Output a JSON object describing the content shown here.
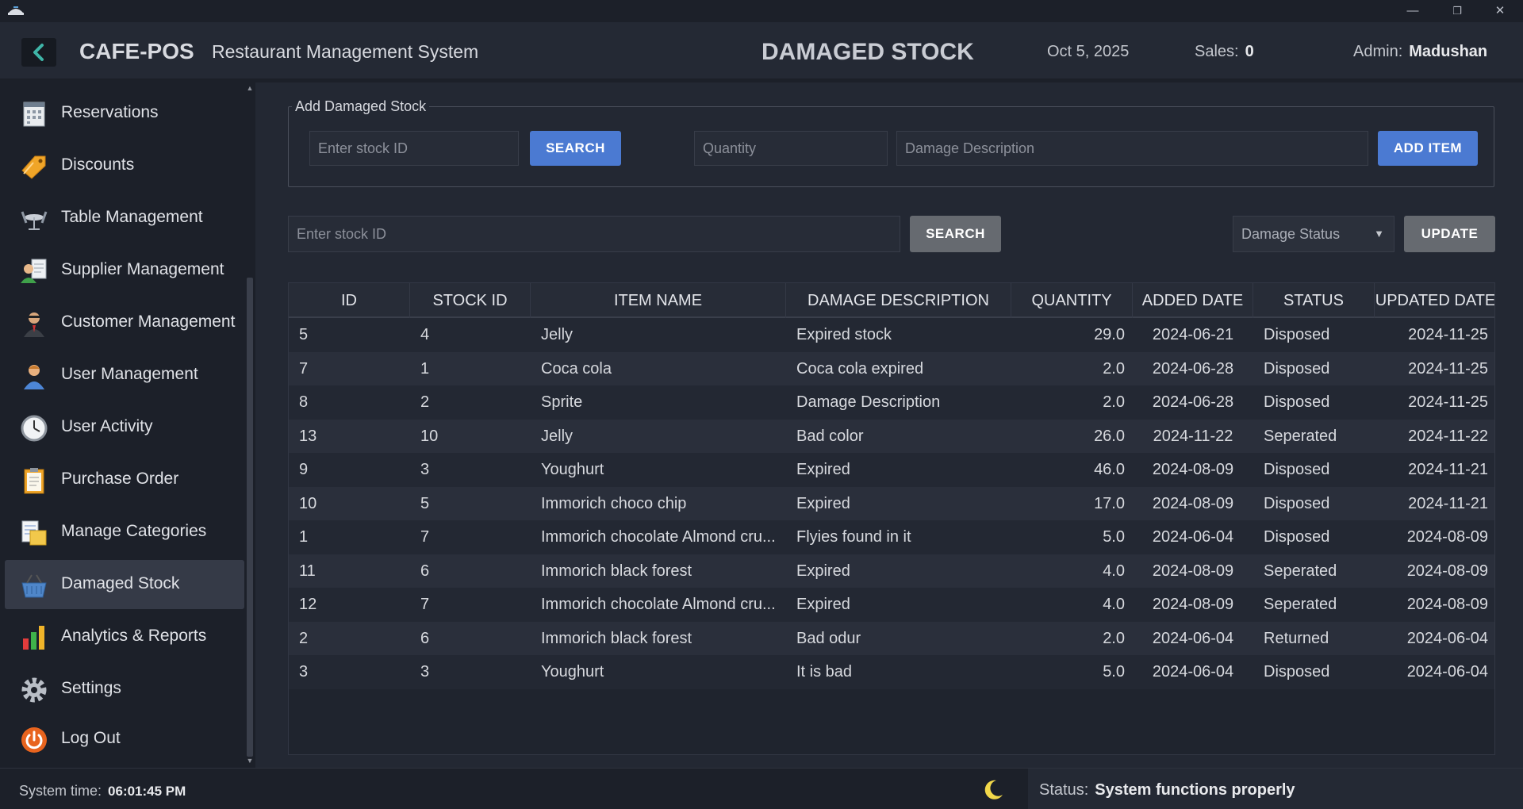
{
  "window": {
    "minimize_glyph": "—",
    "restore_glyph": "❐",
    "close_glyph": "✕"
  },
  "header": {
    "brand": "CAFE-POS",
    "subtitle": "Restaurant Management System",
    "page_title": "DAMAGED STOCK",
    "date": "Oct 5, 2025",
    "sales_label": "Sales:",
    "sales_value": "0",
    "admin_label": "Admin:",
    "admin_name": "Madushan"
  },
  "sidebar": {
    "items": [
      {
        "label": "Reservations",
        "icon": "reservations-icon",
        "active": false
      },
      {
        "label": "Discounts",
        "icon": "discount-tag-icon",
        "active": false
      },
      {
        "label": "Table Management",
        "icon": "table-icon",
        "active": false
      },
      {
        "label": "Supplier Management",
        "icon": "supplier-icon",
        "active": false
      },
      {
        "label": "Customer Management",
        "icon": "customer-icon",
        "active": false
      },
      {
        "label": "User Management",
        "icon": "user-icon",
        "active": false
      },
      {
        "label": "User Activity",
        "icon": "clock-icon",
        "active": false
      },
      {
        "label": "Purchase Order",
        "icon": "clipboard-icon",
        "active": false
      },
      {
        "label": "Manage Categories",
        "icon": "categories-icon",
        "active": false
      },
      {
        "label": "Damaged Stock",
        "icon": "damaged-basket-icon",
        "active": true
      },
      {
        "label": "Analytics & Reports",
        "icon": "bar-chart-icon",
        "active": false
      },
      {
        "label": "Settings",
        "icon": "gear-icon",
        "active": false
      },
      {
        "label": "Log Out",
        "icon": "power-icon",
        "active": false
      }
    ]
  },
  "add_form": {
    "legend": "Add Damaged Stock",
    "stock_id_placeholder": "Enter stock ID",
    "search_label": "SEARCH",
    "quantity_placeholder": "Quantity",
    "description_placeholder": "Damage Description",
    "add_label": "ADD ITEM"
  },
  "update_bar": {
    "stock_id_placeholder": "Enter stock ID",
    "search_label": "SEARCH",
    "status_select": "Damage Status",
    "update_label": "UPDATE"
  },
  "table": {
    "columns": [
      "ID",
      "STOCK ID",
      "ITEM NAME",
      "DAMAGE DESCRIPTION",
      "QUANTITY",
      "ADDED DATE",
      "STATUS",
      "UPDATED DATE"
    ],
    "rows": [
      [
        "5",
        "4",
        "Jelly",
        "Expired stock",
        "29.0",
        "2024-06-21",
        "Disposed",
        "2024-11-25"
      ],
      [
        "7",
        "1",
        "Coca cola",
        "Coca cola expired",
        "2.0",
        "2024-06-28",
        "Disposed",
        "2024-11-25"
      ],
      [
        "8",
        "2",
        "Sprite",
        "Damage Description",
        "2.0",
        "2024-06-28",
        "Disposed",
        "2024-11-25"
      ],
      [
        "13",
        "10",
        "Jelly",
        "Bad color",
        "26.0",
        "2024-11-22",
        "Seperated",
        "2024-11-22"
      ],
      [
        "9",
        "3",
        "Youghurt",
        "Expired",
        "46.0",
        "2024-08-09",
        "Disposed",
        "2024-11-21"
      ],
      [
        "10",
        "5",
        "Immorich choco chip",
        "Expired",
        "17.0",
        "2024-08-09",
        "Disposed",
        "2024-11-21"
      ],
      [
        "1",
        "7",
        "Immorich chocolate Almond cru...",
        "Flyies found in it",
        "5.0",
        "2024-06-04",
        "Disposed",
        "2024-08-09"
      ],
      [
        "11",
        "6",
        "Immorich black forest",
        "Expired",
        "4.0",
        "2024-08-09",
        "Seperated",
        "2024-08-09"
      ],
      [
        "12",
        "7",
        "Immorich chocolate Almond cru...",
        "Expired",
        "4.0",
        "2024-08-09",
        "Seperated",
        "2024-08-09"
      ],
      [
        "2",
        "6",
        "Immorich black forest",
        "Bad odur",
        "2.0",
        "2024-06-04",
        "Returned",
        "2024-06-04"
      ],
      [
        "3",
        "3",
        "Youghurt",
        "It is bad",
        "5.0",
        "2024-06-04",
        "Disposed",
        "2024-06-04"
      ]
    ]
  },
  "statusbar": {
    "time_label": "System time:",
    "time_value": "06:01:45 PM",
    "status_label": "Status:",
    "status_value": "System functions properly"
  },
  "colors": {
    "accent_blue": "#4b7ad2",
    "back_arrow": "#3fb5a8",
    "moon": "#f2d84a"
  }
}
